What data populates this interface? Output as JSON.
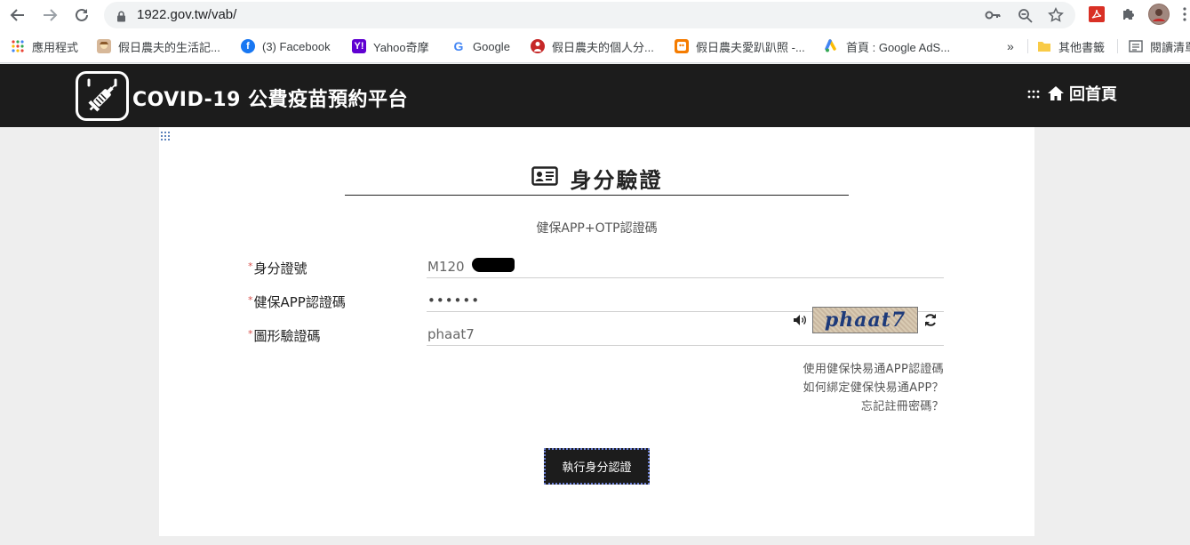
{
  "browser": {
    "url": "1922.gov.tw/vab/",
    "bookmarks": [
      {
        "label": "應用程式",
        "icon": "apps-grid-icon"
      },
      {
        "label": "假日農夫的生活記...",
        "icon": "farmer-avatar-icon"
      },
      {
        "label": "(3) Facebook",
        "icon": "facebook-icon"
      },
      {
        "label": "Yahoo奇摩",
        "icon": "yahoo-icon"
      },
      {
        "label": "Google",
        "icon": "google-icon"
      },
      {
        "label": "假日農夫的個人分...",
        "icon": "blogger-icon"
      },
      {
        "label": "假日農夫愛趴趴照 -...",
        "icon": "photo-icon"
      },
      {
        "label": "首頁 : Google AdS...",
        "icon": "google-ads-icon"
      }
    ],
    "more_label": "»",
    "other_bookmarks": "其他書籤",
    "reading_list": "閱讀清單"
  },
  "site": {
    "title": "COVID-19 公費疫苗預約平台",
    "home_label": "回首頁",
    "accesskey": ":::"
  },
  "form": {
    "heading": "身分驗證",
    "subtitle": "健保APP+OTP認證碼",
    "required_mark": "*",
    "id_label": "身分證號",
    "id_value": "M120",
    "app_code_label": "健保APP認證碼",
    "app_code_value": "••••••",
    "captcha_label": "圖形驗證碼",
    "captcha_value": "phaat7",
    "captcha_image_text": "phaat7",
    "links": [
      "使用健保快易通APP認證碼",
      "如何綁定健保快易通APP？",
      "忘記註冊密碼？"
    ],
    "submit_label": "執行身分認證"
  },
  "colors": {
    "header_bg": "#1c1c1c",
    "page_bg": "#eeeeee",
    "required": "#d9534f",
    "button_focus": "#6b7fd6"
  }
}
